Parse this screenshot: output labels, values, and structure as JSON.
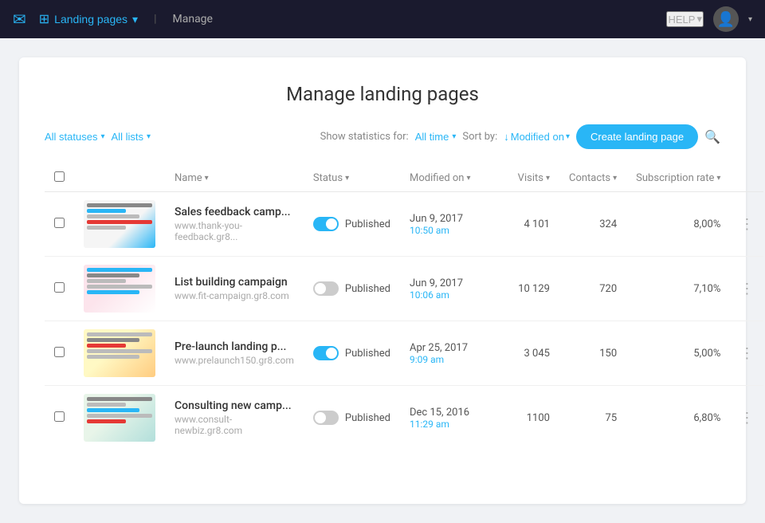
{
  "topnav": {
    "email_icon": "✉",
    "app_name": "Landing pages",
    "app_icon": "⊞",
    "manage_label": "Manage",
    "help_label": "HELP",
    "avatar_icon": "👤"
  },
  "page": {
    "title": "Manage landing pages"
  },
  "filters": {
    "all_statuses": "All statuses",
    "all_lists": "All lists",
    "show_stats_label": "Show statistics for:",
    "all_time": "All time",
    "sort_label": "Sort by:",
    "sort_value": "Modified on",
    "create_btn": "Create landing page"
  },
  "table": {
    "headers": {
      "name": "Name",
      "status": "Status",
      "modified_on": "Modified on",
      "visits": "Visits",
      "contacts": "Contacts",
      "subscription_rate": "Subscription rate"
    },
    "rows": [
      {
        "id": 1,
        "name": "Sales feedback camp...",
        "url": "www.thank-you-feedback.gr8...",
        "status": "Published",
        "status_on": true,
        "date": "Jun 9, 2017",
        "time": "10:50 am",
        "visits": "4 101",
        "contacts": "324",
        "subscription_rate": "8,00%",
        "thumb_class": "thumb-1"
      },
      {
        "id": 2,
        "name": "List building campaign",
        "url": "www.fit-campaign.gr8.com",
        "status": "Published",
        "status_on": false,
        "date": "Jun 9, 2017",
        "time": "10:06 am",
        "visits": "10 129",
        "contacts": "720",
        "subscription_rate": "7,10%",
        "thumb_class": "thumb-2"
      },
      {
        "id": 3,
        "name": "Pre-launch landing p...",
        "url": "www.prelaunch150.gr8.com",
        "status": "Published",
        "status_on": true,
        "date": "Apr 25, 2017",
        "time": "9:09 am",
        "visits": "3 045",
        "contacts": "150",
        "subscription_rate": "5,00%",
        "thumb_class": "thumb-3"
      },
      {
        "id": 4,
        "name": "Consulting new camp...",
        "url": "www.consult-newbiz.gr8.com",
        "status": "Published",
        "status_on": false,
        "date": "Dec 15, 2016",
        "time": "11:29 am",
        "visits": "1100",
        "contacts": "75",
        "subscription_rate": "6,80%",
        "thumb_class": "thumb-4"
      }
    ]
  }
}
